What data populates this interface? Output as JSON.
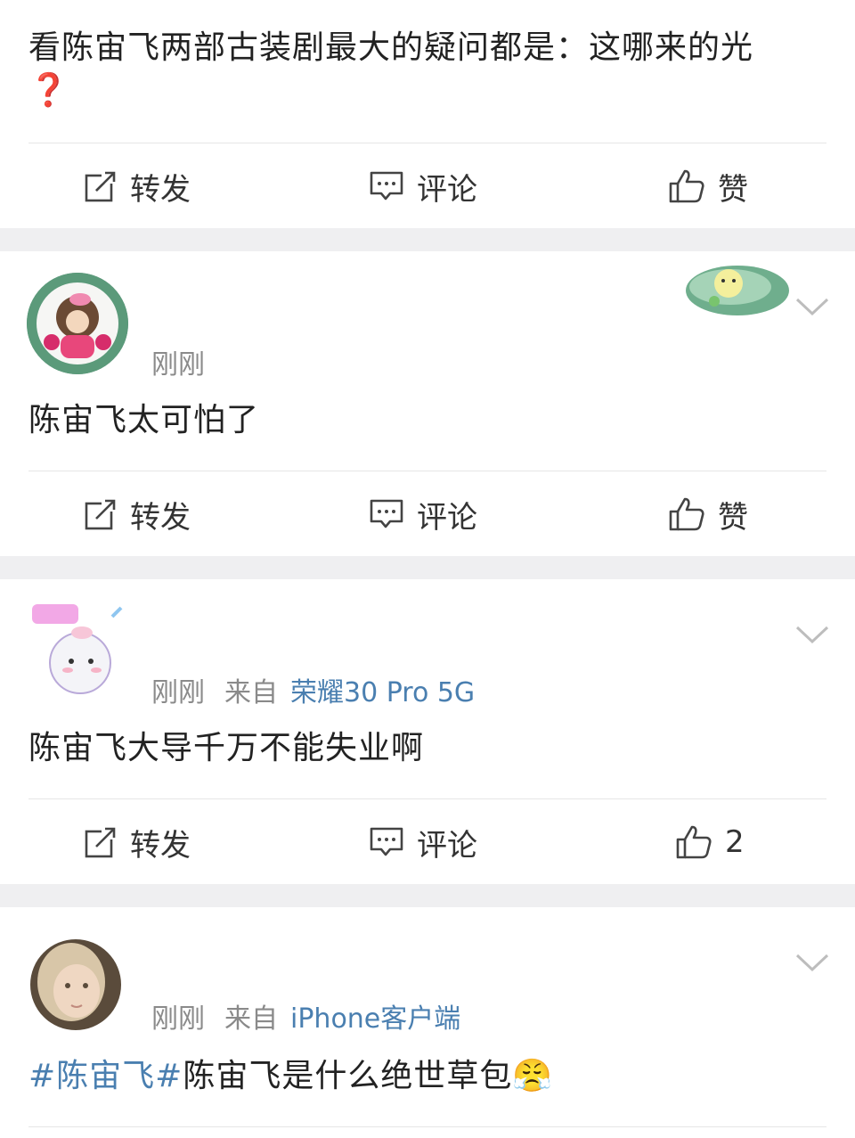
{
  "posts": [
    {
      "text": "看陈宙飞两部古装剧最大的疑问都是：这哪来的光",
      "emoji": "❓",
      "actions": {
        "repost": "转发",
        "comment": "评论",
        "like": "赞"
      }
    },
    {
      "time": "刚刚",
      "text": "陈宙飞太可怕了",
      "actions": {
        "repost": "转发",
        "comment": "评论",
        "like": "赞"
      }
    },
    {
      "time": "刚刚",
      "source_prefix": "来自",
      "device": "荣耀30 Pro 5G",
      "text": "陈宙飞大导千万不能失业啊",
      "actions": {
        "repost": "转发",
        "comment": "评论",
        "like": "2"
      }
    },
    {
      "time": "刚刚",
      "source_prefix": "来自",
      "device": "iPhone客户端",
      "topic": "#陈宙飞#",
      "text": "陈宙飞是什么绝世草包",
      "emoji": "😤"
    }
  ],
  "colors": {
    "accent": "#4a7fb0",
    "gap": "#efeff1",
    "meta": "#8a8a8a"
  }
}
